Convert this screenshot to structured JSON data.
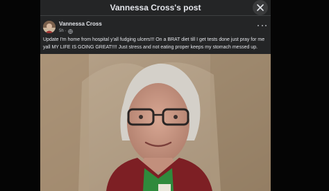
{
  "dialog": {
    "title": "Vannessa Cross's post",
    "close_icon": "close-icon"
  },
  "post": {
    "author": "Vannessa Cross",
    "time": "5h",
    "audience_icon": "globe-icon",
    "more_icon": "more-dots-icon",
    "text": "Update I'm home from hospital y'all fudging ulcers!!! On a BRAT diet till I get tests done just pray for me yall MY LIFE IS GOING GREAT!!!! Just stress and not eating proper keeps my stomach messed up."
  },
  "colors": {
    "dialog_bg": "#242526",
    "text_primary": "#e4e6eb",
    "text_secondary": "#b0b3b8",
    "button_bg": "#3a3b3c"
  }
}
